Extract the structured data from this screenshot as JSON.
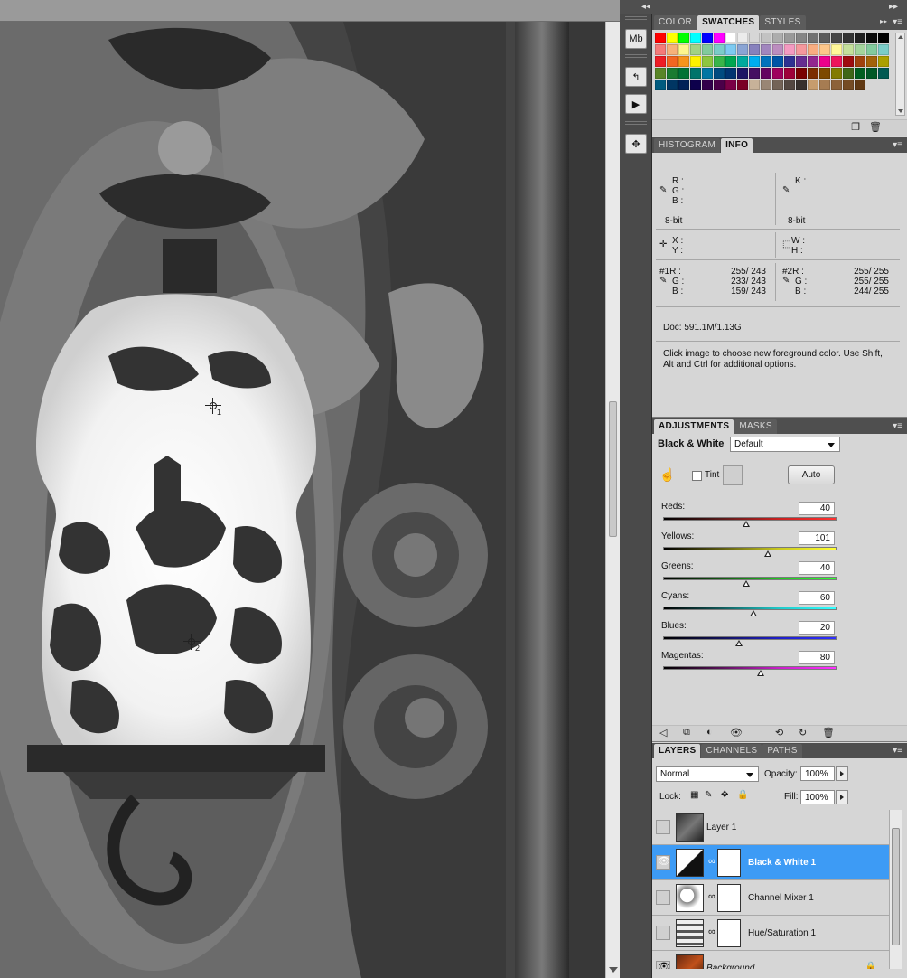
{
  "canvas": {
    "samplers": [
      {
        "id": "1"
      },
      {
        "id": "2"
      }
    ]
  },
  "dock": {
    "expand_label": "◂◂",
    "collapse_label": "▸▸"
  },
  "tools_strip": {
    "items": [
      {
        "icon": "mini-bridge-icon",
        "glyph": "Mb"
      },
      {
        "icon": "history-icon",
        "glyph": "↰"
      },
      {
        "icon": "actions-icon",
        "glyph": "▶"
      },
      {
        "icon": "navigator-icon",
        "glyph": "✥"
      }
    ]
  },
  "swatches_panel": {
    "tabs": [
      "COLOR",
      "SWATCHES",
      "STYLES"
    ],
    "active_tab": "SWATCHES",
    "colors": [
      "#ff0000",
      "#ffff00",
      "#00ff00",
      "#00ffff",
      "#0000ff",
      "#ff00ff",
      "#ffffff",
      "#ebebeb",
      "#d6d6d6",
      "#c2c2c2",
      "#adadad",
      "#999999",
      "#858585",
      "#707070",
      "#5c5c5c",
      "#474747",
      "#333333",
      "#1f1f1f",
      "#0a0a0a",
      "#000000",
      "#f47a79",
      "#f6b17a",
      "#fdf58e",
      "#a2d283",
      "#82ca9c",
      "#7bccc8",
      "#7dcaf1",
      "#8aa4d4",
      "#8781bd",
      "#a186be",
      "#bc8dbf",
      "#f49ac1",
      "#f5989d",
      "#f9ad81",
      "#fdc68a",
      "#fff799",
      "#c4df9b",
      "#a3d39c",
      "#82ca9d",
      "#7bcdc8",
      "#ed1c24",
      "#f26522",
      "#f7941d",
      "#fff200",
      "#8dc63f",
      "#39b54a",
      "#00a651",
      "#00a99d",
      "#00aeef",
      "#0072bc",
      "#0054a6",
      "#2e3192",
      "#662d91",
      "#92278f",
      "#ec008c",
      "#ed145b",
      "#9e0b0f",
      "#a0410d",
      "#a36209",
      "#aba000",
      "#598527",
      "#1a7b30",
      "#007236",
      "#00746b",
      "#0076a3",
      "#004b80",
      "#003471",
      "#1b1464",
      "#440e62",
      "#630460",
      "#9e005d",
      "#9e0039",
      "#790000",
      "#7b2e00",
      "#7d4900",
      "#827b00",
      "#406618",
      "#005e20",
      "#005826",
      "#005952",
      "#005b7f",
      "#003663",
      "#002157",
      "#0d004c",
      "#32004b",
      "#4b0049",
      "#7b0046",
      "#7a0026",
      "#c7b299",
      "#998675",
      "#736357",
      "#534741",
      "#37302d",
      "#c69c6d",
      "#a67c52",
      "#8c6239",
      "#754c24",
      "#603913"
    ]
  },
  "info_panel": {
    "tabs": [
      "HISTOGRAM",
      "INFO"
    ],
    "active_tab": "INFO",
    "rgb_labels": [
      "R :",
      "G :",
      "B :"
    ],
    "k_label": "K :",
    "bit_left": "8-bit",
    "bit_right": "8-bit",
    "xy_labels": [
      "X :",
      "Y :"
    ],
    "wh_labels": [
      "W :",
      "H :"
    ],
    "sampler1": {
      "label": [
        "#1R :",
        "G :",
        "B :"
      ],
      "values": [
        "255/  243",
        "233/  243",
        "159/  243"
      ]
    },
    "sampler2": {
      "label": [
        "#2R :",
        "G :",
        "B :"
      ],
      "values": [
        "255/  255",
        "255/  255",
        "244/  255"
      ]
    },
    "doc": "Doc: 591.1M/1.13G",
    "hint": "Click image to choose new foreground color.  Use Shift, Alt and Ctrl for additional options."
  },
  "adjustments_panel": {
    "tabs": [
      "ADJUSTMENTS",
      "MASKS"
    ],
    "active_tab": "ADJUSTMENTS",
    "title": "Black & White",
    "preset": "Default",
    "tint_label": "Tint",
    "auto_label": "Auto",
    "sliders": [
      {
        "label": "Reds:",
        "value": "40",
        "min": -200,
        "max": 300,
        "gradient": "linear-gradient(90deg,#000,#5a1a1a,#c82020,#ff3030)"
      },
      {
        "label": "Yellows:",
        "value": "101",
        "min": -200,
        "max": 300,
        "gradient": "linear-gradient(90deg,#000,#5a5a10,#c8c820,#ffff30)"
      },
      {
        "label": "Greens:",
        "value": "40",
        "min": -200,
        "max": 300,
        "gradient": "linear-gradient(90deg,#000,#125a12,#20c820,#30ff30)"
      },
      {
        "label": "Cyans:",
        "value": "60",
        "min": -200,
        "max": 300,
        "gradient": "linear-gradient(90deg,#000,#125a5a,#20c8c8,#30ffff)"
      },
      {
        "label": "Blues:",
        "value": "20",
        "min": -200,
        "max": 300,
        "gradient": "linear-gradient(90deg,#000,#12125a,#2020c8,#3030ff)"
      },
      {
        "label": "Magentas:",
        "value": "80",
        "min": -200,
        "max": 300,
        "gradient": "linear-gradient(90deg,#000,#5a125a,#c820c8,#ff30ff)"
      }
    ]
  },
  "layers_panel": {
    "tabs": [
      "LAYERS",
      "CHANNELS",
      "PATHS"
    ],
    "active_tab": "LAYERS",
    "blend_mode": "Normal",
    "opacity_label": "Opacity:",
    "opacity": "100%",
    "lock_label": "Lock:",
    "fill_label": "Fill:",
    "fill": "100%",
    "layers": [
      {
        "name": "Layer 1",
        "visible": false,
        "selected": false,
        "type": "pixel",
        "has_mask": false
      },
      {
        "name": "Black & White 1",
        "visible": true,
        "selected": true,
        "type": "bw",
        "has_mask": true
      },
      {
        "name": "Channel Mixer 1",
        "visible": false,
        "selected": false,
        "type": "mixer",
        "has_mask": true
      },
      {
        "name": "Hue/Saturation 1",
        "visible": false,
        "selected": false,
        "type": "hue",
        "has_mask": true
      },
      {
        "name": "Background",
        "visible": true,
        "selected": false,
        "type": "background",
        "has_mask": false
      }
    ]
  },
  "accent": "#3d9bf5"
}
